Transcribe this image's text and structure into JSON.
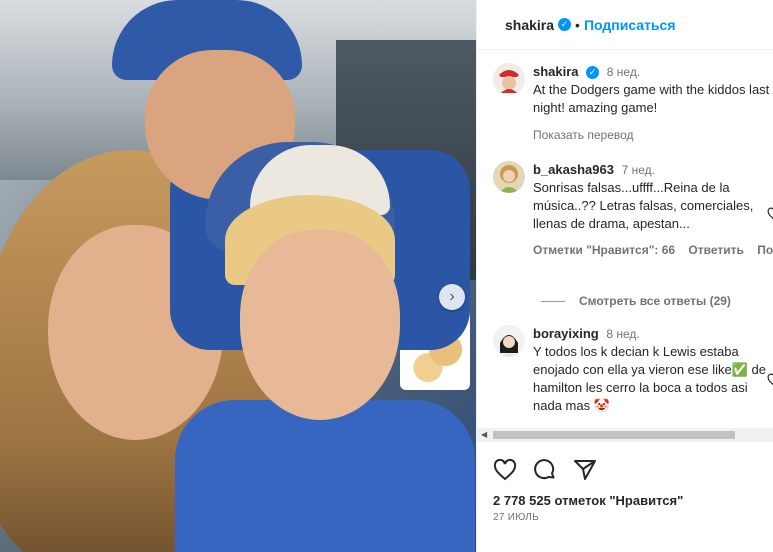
{
  "post": {
    "author": "shakira",
    "follow_label": "Подписаться",
    "nav_next_icon": "chevron-right-icon"
  },
  "caption": {
    "username": "shakira",
    "time": "8 нед.",
    "text": "At the Dodgers game with the kiddos last night! amazing game!",
    "translate": "Показать перевод"
  },
  "comments": [
    {
      "username": "b_akasha963",
      "time": "7 нед.",
      "text": "Sonrisas falsas...uffff...Reina de la música..?? Letras falsas, comerciales, llenas de drama, apestan...",
      "likes": "Отметки \"Нравится\": 66",
      "reply": "Ответить",
      "more": "Пожа",
      "view_replies": "Смотреть все ответы (29)"
    },
    {
      "username": "borayixing",
      "time": "8 нед.",
      "text": "Y todos los k decian k Lewis estaba enojado con ella ya vieron ese like✅ de hamilton les cerro la boca a todos asi nada mas 🤡"
    }
  ],
  "footer": {
    "likes": "2 778 525 отметок \"Нравится\"",
    "date": "27 ИЮЛЬ"
  },
  "colors": {
    "accent": "#0095f6",
    "text": "#262626",
    "muted": "#737373"
  }
}
